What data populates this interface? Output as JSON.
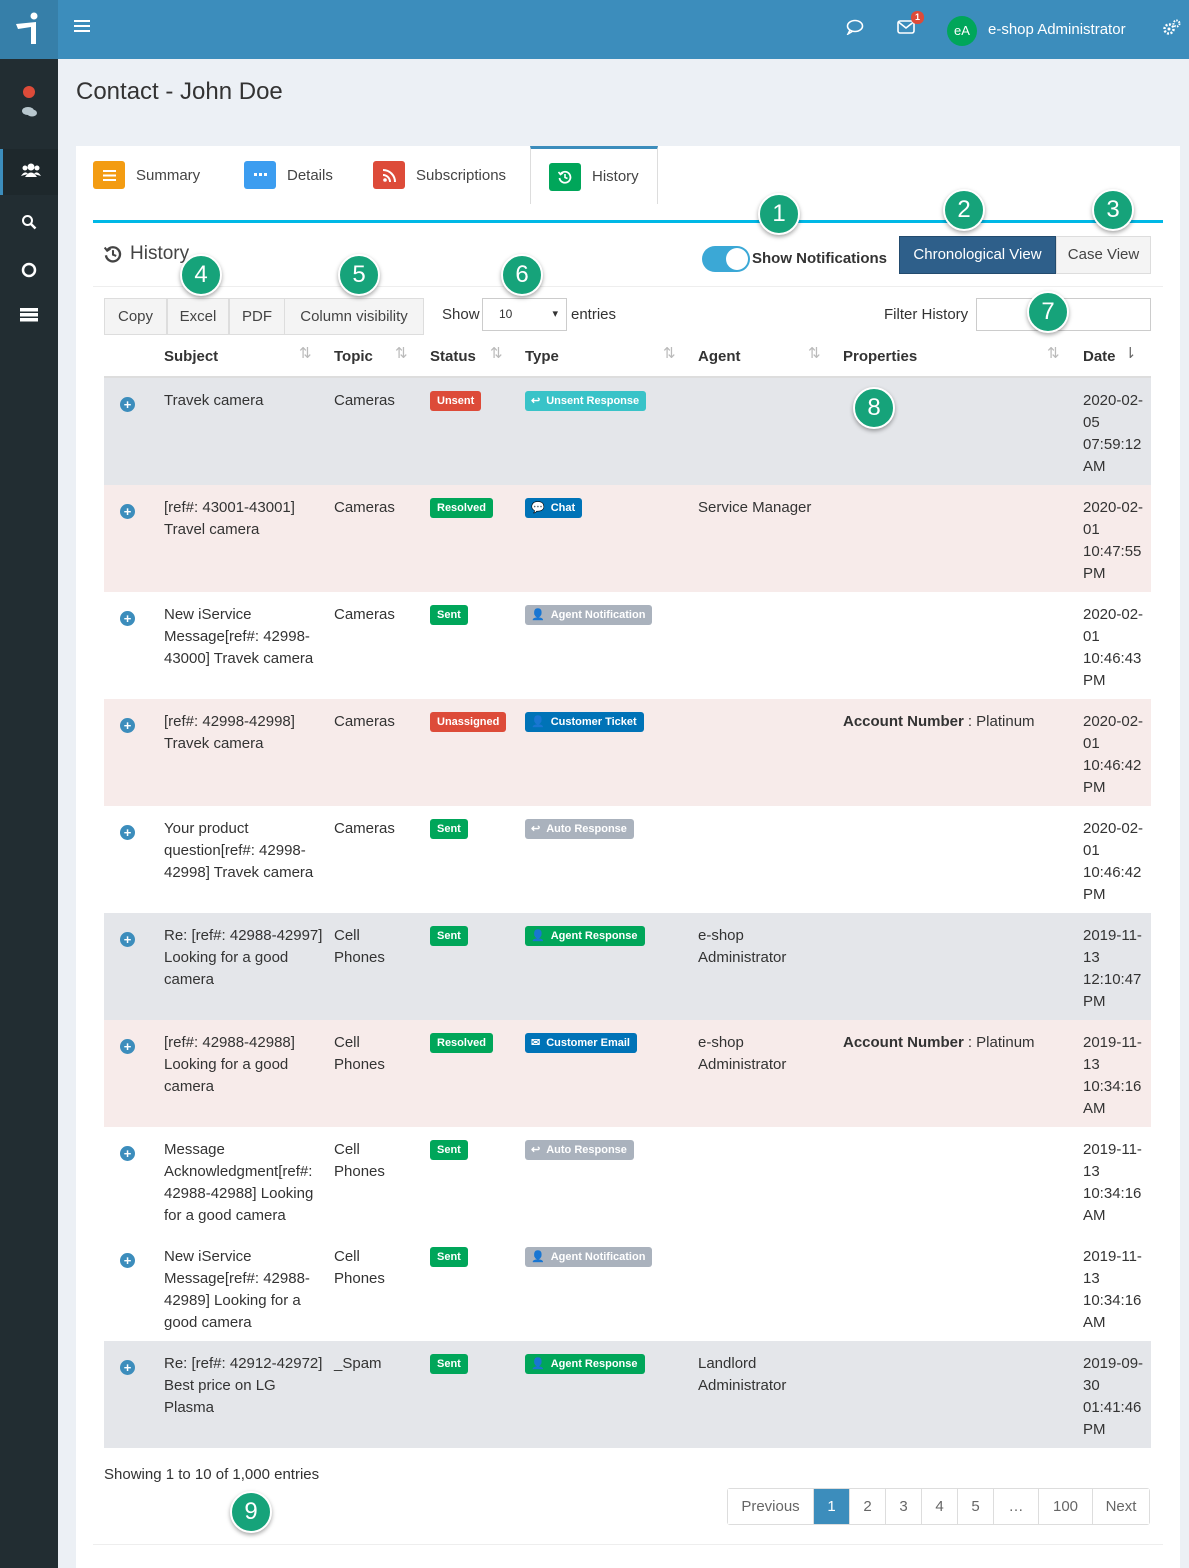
{
  "topbar": {
    "username": "e-shop Administrator",
    "avatar_initials": "eA",
    "mail_badge": "1"
  },
  "page": {
    "title": "Contact - John Doe"
  },
  "tabs": [
    {
      "label": "Summary",
      "color": "#f39c12",
      "icon": "list-icon"
    },
    {
      "label": "Details",
      "color": "#3c9df0",
      "icon": "ellipsis-icon"
    },
    {
      "label": "Subscriptions",
      "color": "#dd4b39",
      "icon": "rss-icon"
    },
    {
      "label": "History",
      "color": "#00a65a",
      "icon": "history-icon"
    }
  ],
  "history": {
    "title": "History",
    "toggle_label": "Show Notifications",
    "chronological_label": "Chronological View",
    "case_view_label": "Case View"
  },
  "toolbar": {
    "copy": "Copy",
    "excel": "Excel",
    "pdf": "PDF",
    "colvis": "Column visibility",
    "show_label": "Show",
    "entries_label": "entries",
    "page_size": "10",
    "filter_label": "Filter History",
    "filter_value": ""
  },
  "columns": {
    "subject": "Subject",
    "topic": "Topic",
    "status": "Status",
    "type": "Type",
    "agent": "Agent",
    "properties": "Properties",
    "date": "Date"
  },
  "rows": [
    {
      "subject": [
        "Travek camera"
      ],
      "topic": [
        "Cameras"
      ],
      "status": "Unsent",
      "type": "Unsent Response",
      "agent": [],
      "prop_key": "",
      "prop_val": "",
      "date": [
        "2020-02-",
        "05",
        "07:59:12",
        "AM"
      ]
    },
    {
      "subject": [
        "[ref#: 43001-43001]",
        "Travel camera"
      ],
      "topic": [
        "Cameras"
      ],
      "status": "Resolved",
      "type": "Chat",
      "agent": [
        "Service Manager"
      ],
      "prop_key": "",
      "prop_val": "",
      "date": [
        "2020-02-",
        "01",
        "10:47:55",
        "PM"
      ]
    },
    {
      "subject": [
        "New iService",
        "Message[ref#: 42998-",
        "43000] Travek camera"
      ],
      "topic": [
        "Cameras"
      ],
      "status": "Sent",
      "type": "Agent Notification",
      "agent": [],
      "prop_key": "",
      "prop_val": "",
      "date": [
        "2020-02-",
        "01",
        "10:46:43",
        "PM"
      ]
    },
    {
      "subject": [
        "[ref#: 42998-42998]",
        "Travek camera"
      ],
      "topic": [
        "Cameras"
      ],
      "status": "Unassigned",
      "type": "Customer Ticket",
      "agent": [],
      "prop_key": "Account Number",
      "prop_val": ": Platinum",
      "date": [
        "2020-02-",
        "01",
        "10:46:42",
        "PM"
      ]
    },
    {
      "subject": [
        "Your product",
        "question[ref#: 42998-",
        "42998] Travek camera"
      ],
      "topic": [
        "Cameras"
      ],
      "status": "Sent",
      "type": "Auto Response",
      "agent": [],
      "prop_key": "",
      "prop_val": "",
      "date": [
        "2020-02-",
        "01",
        "10:46:42",
        "PM"
      ]
    },
    {
      "subject": [
        "Re: [ref#: 42988-42997]",
        "Looking for a good",
        "camera"
      ],
      "topic": [
        "Cell",
        "Phones"
      ],
      "status": "Sent",
      "type": "Agent Response",
      "agent": [
        "e-shop",
        "Administrator"
      ],
      "prop_key": "",
      "prop_val": "",
      "date": [
        "2019-11-",
        "13",
        "12:10:47",
        "PM"
      ]
    },
    {
      "subject": [
        "[ref#: 42988-42988]",
        "Looking for a good",
        "camera"
      ],
      "topic": [
        "Cell",
        "Phones"
      ],
      "status": "Resolved",
      "type": "Customer Email",
      "agent": [
        "e-shop",
        "Administrator"
      ],
      "prop_key": "Account Number",
      "prop_val": ": Platinum",
      "date": [
        "2019-11-",
        "13",
        "10:34:16",
        "AM"
      ]
    },
    {
      "subject": [
        "Message",
        "Acknowledgment[ref#:",
        "42988-42988] Looking",
        "for a good camera"
      ],
      "topic": [
        "Cell",
        "Phones"
      ],
      "status": "Sent",
      "type": "Auto Response",
      "agent": [],
      "prop_key": "",
      "prop_val": "",
      "date": [
        "2019-11-",
        "13",
        "10:34:16",
        "AM"
      ]
    },
    {
      "subject": [
        "New iService",
        "Message[ref#: 42988-",
        "42989] Looking for a",
        "good camera"
      ],
      "topic": [
        "Cell",
        "Phones"
      ],
      "status": "Sent",
      "type": "Agent Notification",
      "agent": [],
      "prop_key": "",
      "prop_val": "",
      "date": [
        "2019-11-",
        "13",
        "10:34:16",
        "AM"
      ]
    },
    {
      "subject": [
        "Re: [ref#: 42912-42972]",
        "Best price on LG",
        "Plasma"
      ],
      "topic": [
        "_Spam"
      ],
      "status": "Sent",
      "type": "Agent Response",
      "agent": [
        "Landlord",
        "Administrator"
      ],
      "prop_key": "",
      "prop_val": "",
      "date": [
        "2019-09-",
        "30",
        "01:41:46",
        "PM"
      ]
    }
  ],
  "footer": {
    "info": "Showing 1 to 10 of 1,000 entries"
  },
  "pagination": [
    "Previous",
    "1",
    "2",
    "3",
    "4",
    "5",
    "…",
    "100",
    "Next"
  ],
  "callouts": [
    "1",
    "2",
    "3",
    "4",
    "5",
    "6",
    "7",
    "8",
    "9"
  ],
  "colors": {
    "Unsent": "#dd4b39",
    "Resolved": "#00a65a",
    "Sent": "#00a65a",
    "Unassigned": "#dd4b39",
    "Unsent Response": "#39c3c8",
    "Chat": "#0073b7",
    "Agent Notification": "#aab2bd",
    "Customer Ticket": "#0073b7",
    "Auto Response": "#aab2bd",
    "Agent Response": "#00a65a",
    "Customer Email": "#0073b7",
    "accent": "#3c8dbc"
  }
}
